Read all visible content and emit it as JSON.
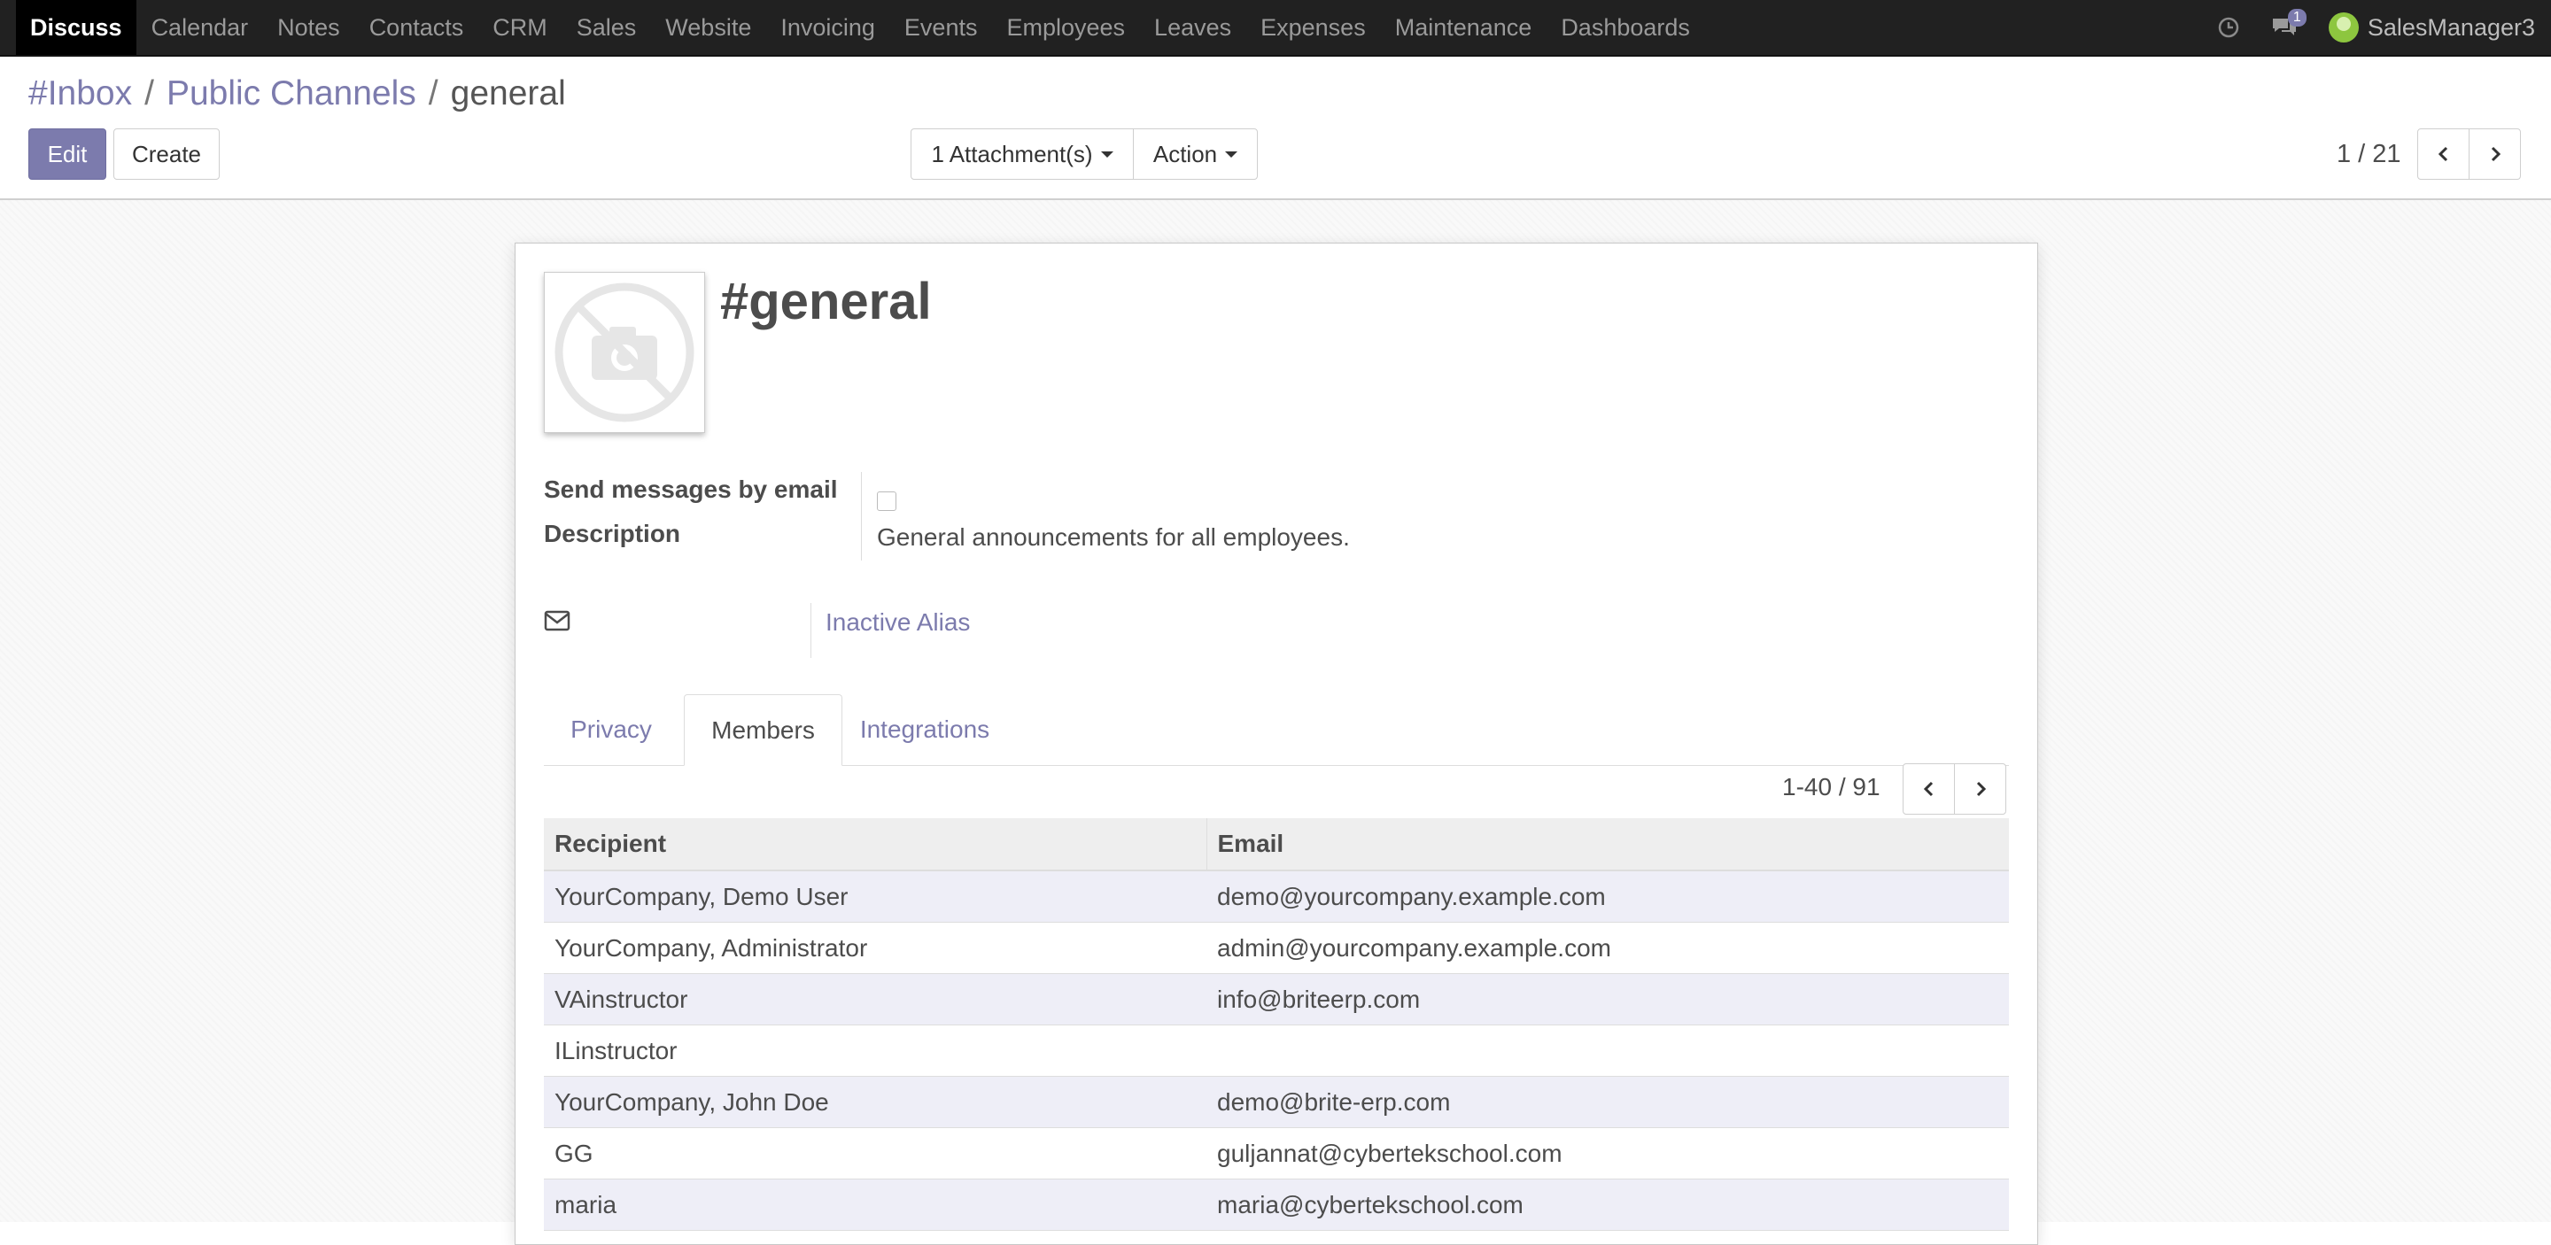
{
  "navbar": {
    "active_app": "Discuss",
    "menu": [
      "Calendar",
      "Notes",
      "Contacts",
      "CRM",
      "Sales",
      "Website",
      "Invoicing",
      "Events",
      "Employees",
      "Leaves",
      "Expenses",
      "Maintenance",
      "Dashboards"
    ],
    "messages_badge": "1",
    "user_name": "SalesManager3"
  },
  "breadcrumb": {
    "items": [
      "#Inbox",
      "Public Channels"
    ],
    "current": "general",
    "separator": "/"
  },
  "toolbar": {
    "edit_label": "Edit",
    "create_label": "Create",
    "attachments_label": "1 Attachment(s)",
    "action_label": "Action"
  },
  "pager": {
    "value": "1 / 21"
  },
  "record": {
    "title": "#general",
    "send_email_label": "Send messages by email",
    "send_email_checked": false,
    "description_label": "Description",
    "description_value": "General announcements for all employees.",
    "alias_value": "Inactive Alias"
  },
  "tabs": [
    {
      "label": "Privacy",
      "active": false
    },
    {
      "label": "Members",
      "active": true
    },
    {
      "label": "Integrations",
      "active": false
    }
  ],
  "members": {
    "pager": "1-40 / 91",
    "columns": [
      "Recipient",
      "Email"
    ],
    "rows": [
      [
        "YourCompany, Demo User",
        "demo@yourcompany.example.com"
      ],
      [
        "YourCompany, Administrator",
        "admin@yourcompany.example.com"
      ],
      [
        "VAinstructor",
        "info@briteerp.com"
      ],
      [
        "ILinstructor",
        ""
      ],
      [
        "YourCompany, John Doe",
        "demo@brite-erp.com"
      ],
      [
        "GG",
        "guljannat@cybertekschool.com"
      ],
      [
        "maria",
        "maria@cybertekschool.com"
      ]
    ]
  },
  "colors": {
    "brand": "#7c7bad",
    "navbar": "#212121"
  }
}
